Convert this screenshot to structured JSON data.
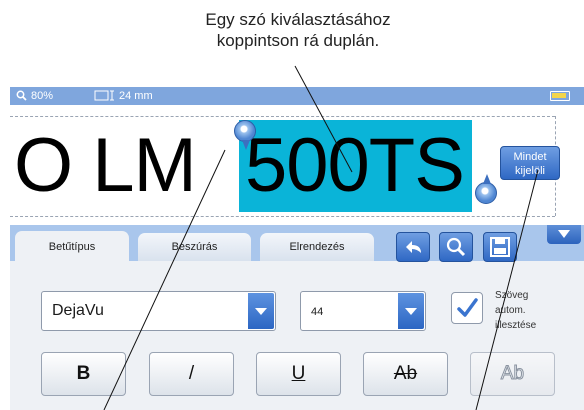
{
  "callout": {
    "line1": "Egy szó kiválasztásához",
    "line2": "koppintson rá duplán."
  },
  "statusbar": {
    "zoom": "80%",
    "label_width": "24 mm"
  },
  "label": {
    "plain_text": "O LM",
    "selected_text": "500TS"
  },
  "select_all": {
    "line1": "Mindet",
    "line2": "kijelöli"
  },
  "tabs": [
    {
      "label": "Betűtípus",
      "active": true
    },
    {
      "label": "Beszúrás",
      "active": false
    },
    {
      "label": "Elrendezés",
      "active": false
    }
  ],
  "toolbar": {
    "icons": [
      "undo-icon",
      "zoom-icon",
      "save-icon",
      "collapse-icon"
    ]
  },
  "font": {
    "family": "DejaVu",
    "size": "44"
  },
  "autofit": {
    "checked": true,
    "line1": "Szöveg",
    "line2": "autom.",
    "line3": "illesztése"
  },
  "format_buttons": {
    "bold": "B",
    "italic": "/",
    "underline": "U",
    "strikethrough": "Ab",
    "outline": "Ab"
  },
  "colors": {
    "status_bar": "#7fa6dd",
    "selection": "#0ab4d8",
    "panel": "#a9c6ec",
    "button_blue": "#2f68c4"
  }
}
